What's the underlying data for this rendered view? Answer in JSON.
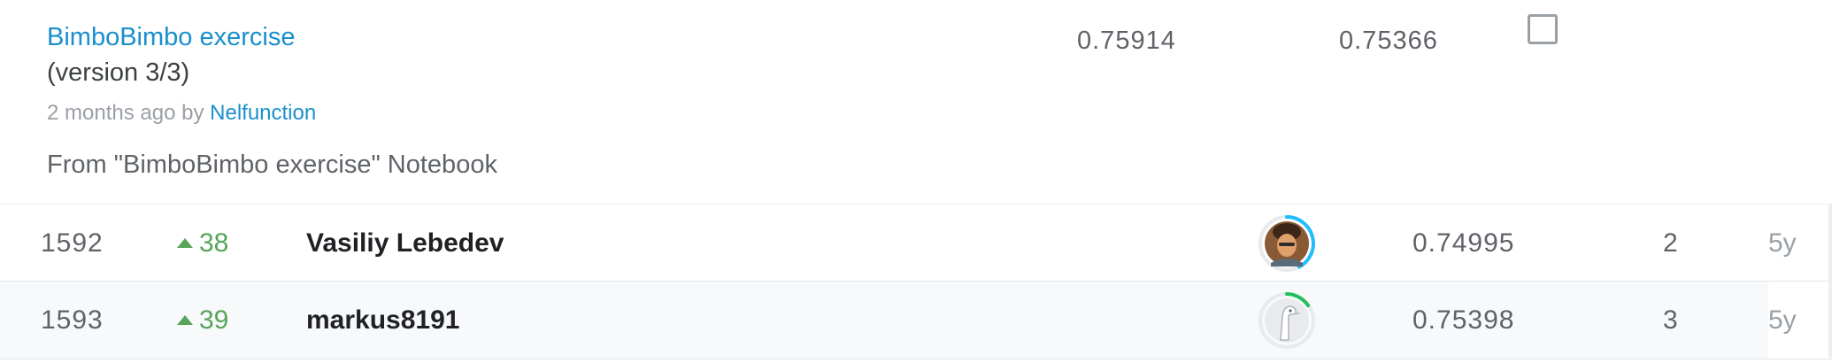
{
  "submission": {
    "title": "BimboBimbo exercise",
    "version": "(version 3/3)",
    "time": "2 months ago",
    "by": "by",
    "author": "Nelfunction",
    "source_note": "From \"BimboBimbo exercise\" Notebook",
    "private_score": "0.75914",
    "public_score": "0.75366",
    "selected": false
  },
  "leaderboard": [
    {
      "rank": "1592",
      "change": "38",
      "change_direction": "up",
      "team": "Vasiliy Lebedev",
      "avatar_icon": "user-photo-avatar",
      "tier_ring_color": "#20beff",
      "tier_ring_progress": 0.3,
      "score": "0.74995",
      "entries": "2",
      "last": "5y"
    },
    {
      "rank": "1593",
      "change": "39",
      "change_direction": "up",
      "team": "markus8191",
      "avatar_icon": "default-goose-avatar",
      "tier_ring_color": "#20c05c",
      "tier_ring_progress": 0.18,
      "score": "0.75398",
      "entries": "3",
      "last": "5y"
    }
  ],
  "colors": {
    "link": "#1a8fcd",
    "positive": "#57a55a"
  }
}
